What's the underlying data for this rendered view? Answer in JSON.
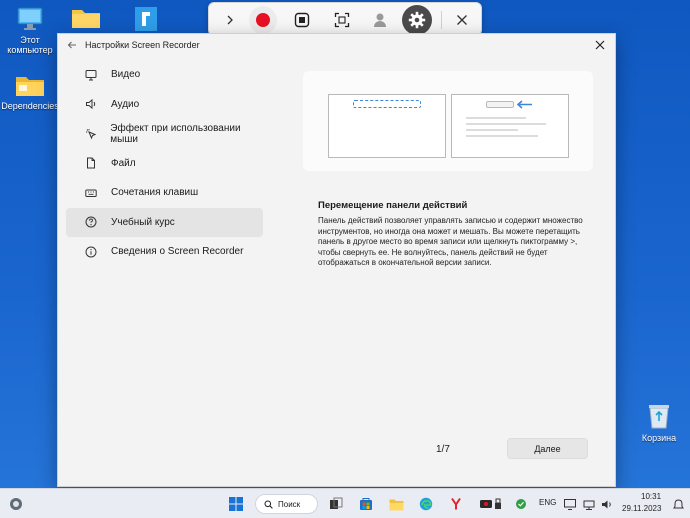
{
  "desktop": {
    "icons": [
      {
        "label": "Этот компьютер"
      },
      {
        "label": "Dependencies"
      },
      {
        "label": "Корзина"
      }
    ]
  },
  "toolbar": {
    "buttons": [
      "chevron-right-icon",
      "record-icon",
      "stop-icon",
      "capture-region-icon",
      "webcam-icon",
      "gear-icon",
      "close-icon"
    ],
    "record_color": "#e81123"
  },
  "window": {
    "title": "Настройки Screen Recorder",
    "nav": [
      {
        "label": "Видео",
        "icon": "monitor-icon"
      },
      {
        "label": "Аудио",
        "icon": "speaker-icon"
      },
      {
        "label": "Эффект при использовании мыши",
        "icon": "cursor-click-icon"
      },
      {
        "label": "Файл",
        "icon": "file-icon"
      },
      {
        "label": "Сочетания клавиш",
        "icon": "keyboard-icon"
      },
      {
        "label": "Учебный курс",
        "icon": "question-icon",
        "active": true
      },
      {
        "label": "Сведения о Screen Recorder",
        "icon": "info-icon"
      }
    ],
    "content": {
      "heading": "Перемещение панели действий",
      "description": "Панель действий позволяет управлять записью и содержит множество инструментов, но иногда она может и мешать. Вы можете перетащить панель в другое место во время записи или щелкнуть пиктограмму >, чтобы свернуть ее. Не волнуйтесь, панель действий не будет отображаться в окончательной версии записи.",
      "pager": "1/7",
      "next_label": "Далее"
    },
    "accent": "#3f86d8"
  },
  "taskbar": {
    "search_label": "Поиск",
    "language": "ENG",
    "time": "10:31",
    "date": "29.11.2023"
  }
}
